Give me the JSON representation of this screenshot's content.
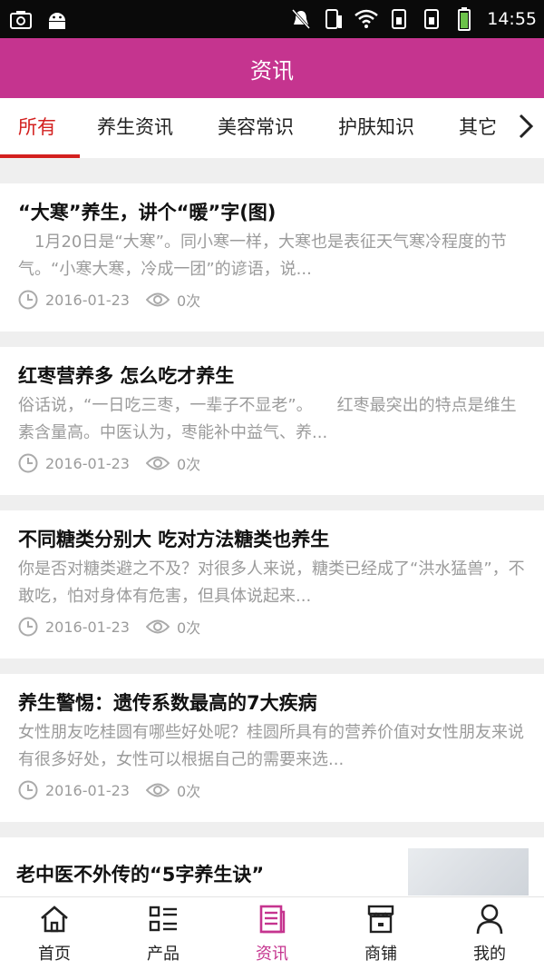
{
  "status_bar": {
    "time": "14:55"
  },
  "header": {
    "title": "资讯"
  },
  "tabs": [
    {
      "label": "所有",
      "active": true
    },
    {
      "label": "养生资讯",
      "active": false
    },
    {
      "label": "美容常识",
      "active": false
    },
    {
      "label": "护肤知识",
      "active": false
    },
    {
      "label": "其它",
      "active": false
    }
  ],
  "articles": [
    {
      "title": "“大寒”养生，讲个“暖”字(图)",
      "summary": "　1月20日是“大寒”。同小寒一样，大寒也是表征天气寒冷程度的节气。“小寒大寒，冷成一团”的谚语，说...",
      "date": "2016-01-23",
      "views": "0次"
    },
    {
      "title": "红枣营养多 怎么吃才养生",
      "summary": "俗话说，“一日吃三枣，一辈子不显老”。　　红枣最突出的特点是维生素含量高。中医认为，枣能补中益气、养...",
      "date": "2016-01-23",
      "views": "0次"
    },
    {
      "title": "不同糖类分别大 吃对方法糖类也养生",
      "summary": "你是否对糖类避之不及？对很多人来说，糖类已经成了“洪水猛兽”，不敢吃，怕对身体有危害，但具体说起来...",
      "date": "2016-01-23",
      "views": "0次"
    },
    {
      "title": "养生警惕：遗传系数最高的7大疾病",
      "summary": "女性朋友吃桂圆有哪些好处呢？桂圆所具有的营养价值对女性朋友来说有很多好处，女性可以根据自己的需要来选...",
      "date": "2016-01-23",
      "views": "0次"
    },
    {
      "title": "老中医不外传的“5字养生诀”"
    }
  ],
  "bottom_nav": [
    {
      "label": "首页",
      "icon": "home-icon"
    },
    {
      "label": "产品",
      "icon": "product-list-icon"
    },
    {
      "label": "资讯",
      "icon": "news-icon",
      "active": true
    },
    {
      "label": "商铺",
      "icon": "shop-icon"
    },
    {
      "label": "我的",
      "icon": "user-icon"
    }
  ],
  "colors": {
    "accent": "#c5348f",
    "tab_active": "#d3201f",
    "meta": "#9b9b9b"
  }
}
